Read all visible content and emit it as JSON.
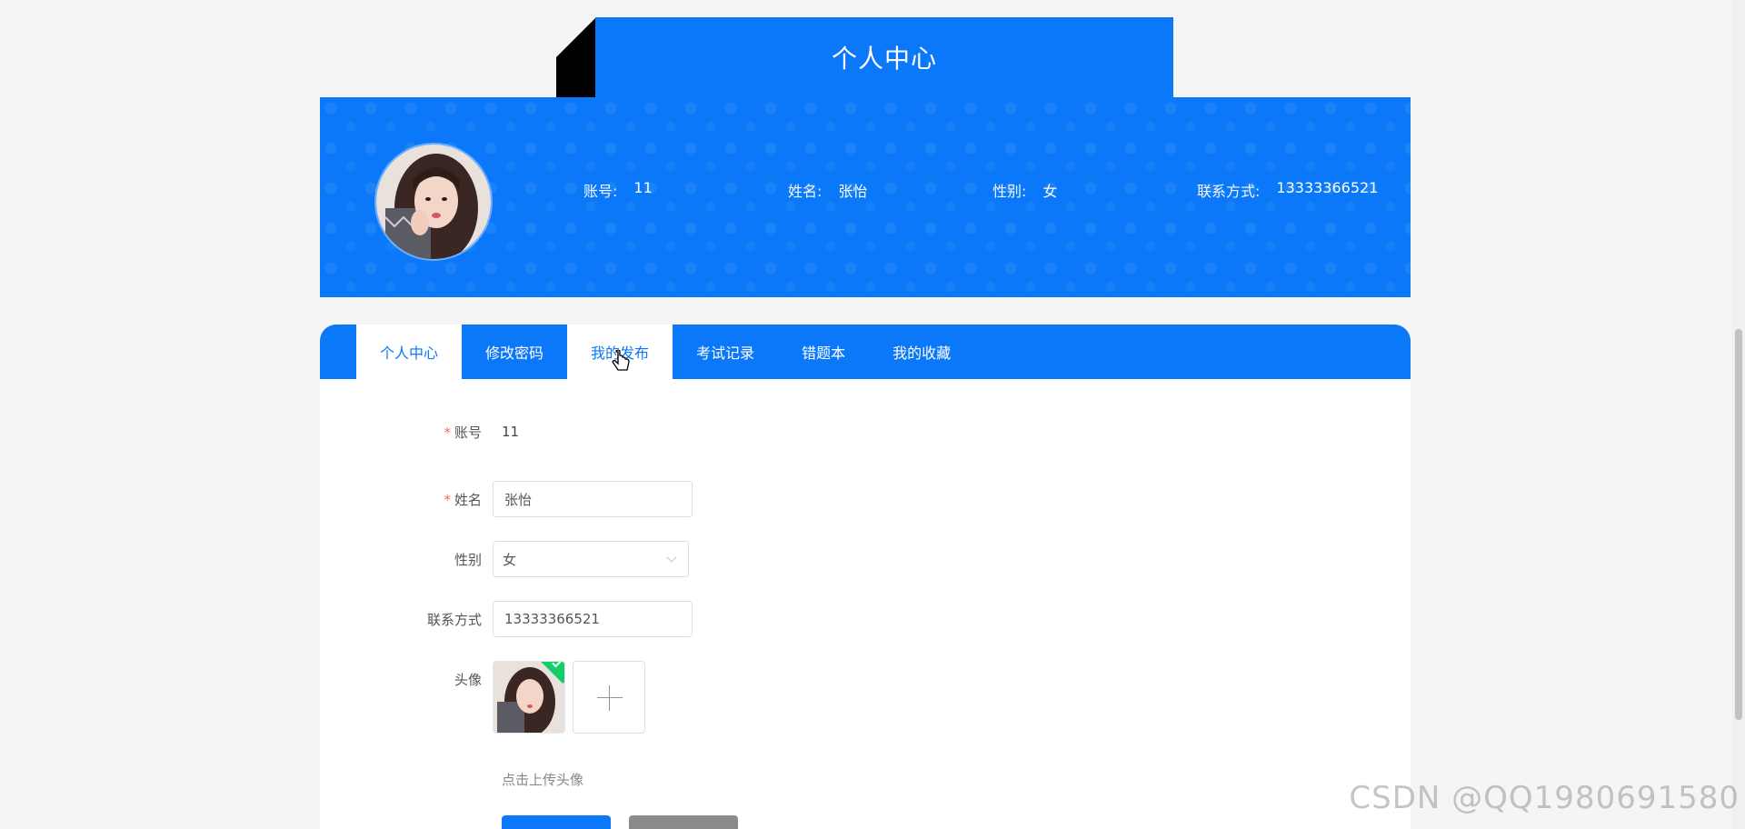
{
  "header": {
    "title": "个人中心"
  },
  "profile": {
    "account_label": "账号:",
    "account_value": "11",
    "name_label": "姓名:",
    "name_value": "张怡",
    "gender_label": "性别:",
    "gender_value": "女",
    "contact_label": "联系方式:",
    "contact_value": "13333366521"
  },
  "tabs": [
    {
      "label": "个人中心"
    },
    {
      "label": "修改密码"
    },
    {
      "label": "我的发布"
    },
    {
      "label": "考试记录"
    },
    {
      "label": "错题本"
    },
    {
      "label": "我的收藏"
    }
  ],
  "form": {
    "account_label": "账号",
    "account_value": "11",
    "name_label": "姓名",
    "name_value": "张怡",
    "gender_label": "性别",
    "gender_value": "女",
    "contact_label": "联系方式",
    "contact_value": "13333366521",
    "avatar_label": "头像",
    "upload_hint": "点击上传头像"
  },
  "watermark": "CSDN @QQ1980691580",
  "colors": {
    "brand": "#0a78f8",
    "success": "#13ce66",
    "required": "#f56c6c"
  }
}
